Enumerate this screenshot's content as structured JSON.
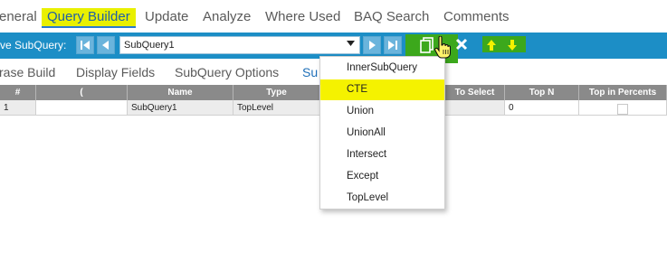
{
  "top_tabs": [
    {
      "label": "eneral"
    },
    {
      "label": "Query Builder"
    },
    {
      "label": "Update"
    },
    {
      "label": "Analyze"
    },
    {
      "label": "Where Used"
    },
    {
      "label": "BAQ Search"
    },
    {
      "label": "Comments"
    }
  ],
  "toolbar": {
    "label": "ve SubQuery:",
    "combo_value": "SubQuery1"
  },
  "sub_tabs": [
    {
      "label": "rase Build"
    },
    {
      "label": "Display Fields"
    },
    {
      "label": "SubQuery Options"
    },
    {
      "label": "Su"
    }
  ],
  "grid": {
    "headers": [
      "#",
      "(",
      "Name",
      "Type",
      "To Select",
      "Top N",
      "Top in Percents"
    ],
    "row": [
      "1",
      "",
      "SubQuery1",
      "TopLevel",
      "",
      "0",
      ""
    ]
  },
  "dropdown": {
    "options": [
      "InnerSubQuery",
      "CTE",
      "Union",
      "UnionAll",
      "Intersect",
      "Except",
      "TopLevel"
    ],
    "highlighted": "CTE"
  },
  "colors": {
    "highlight": "#f5f200",
    "toolbar": "#1c8ec6",
    "green": "#3ca81c"
  }
}
